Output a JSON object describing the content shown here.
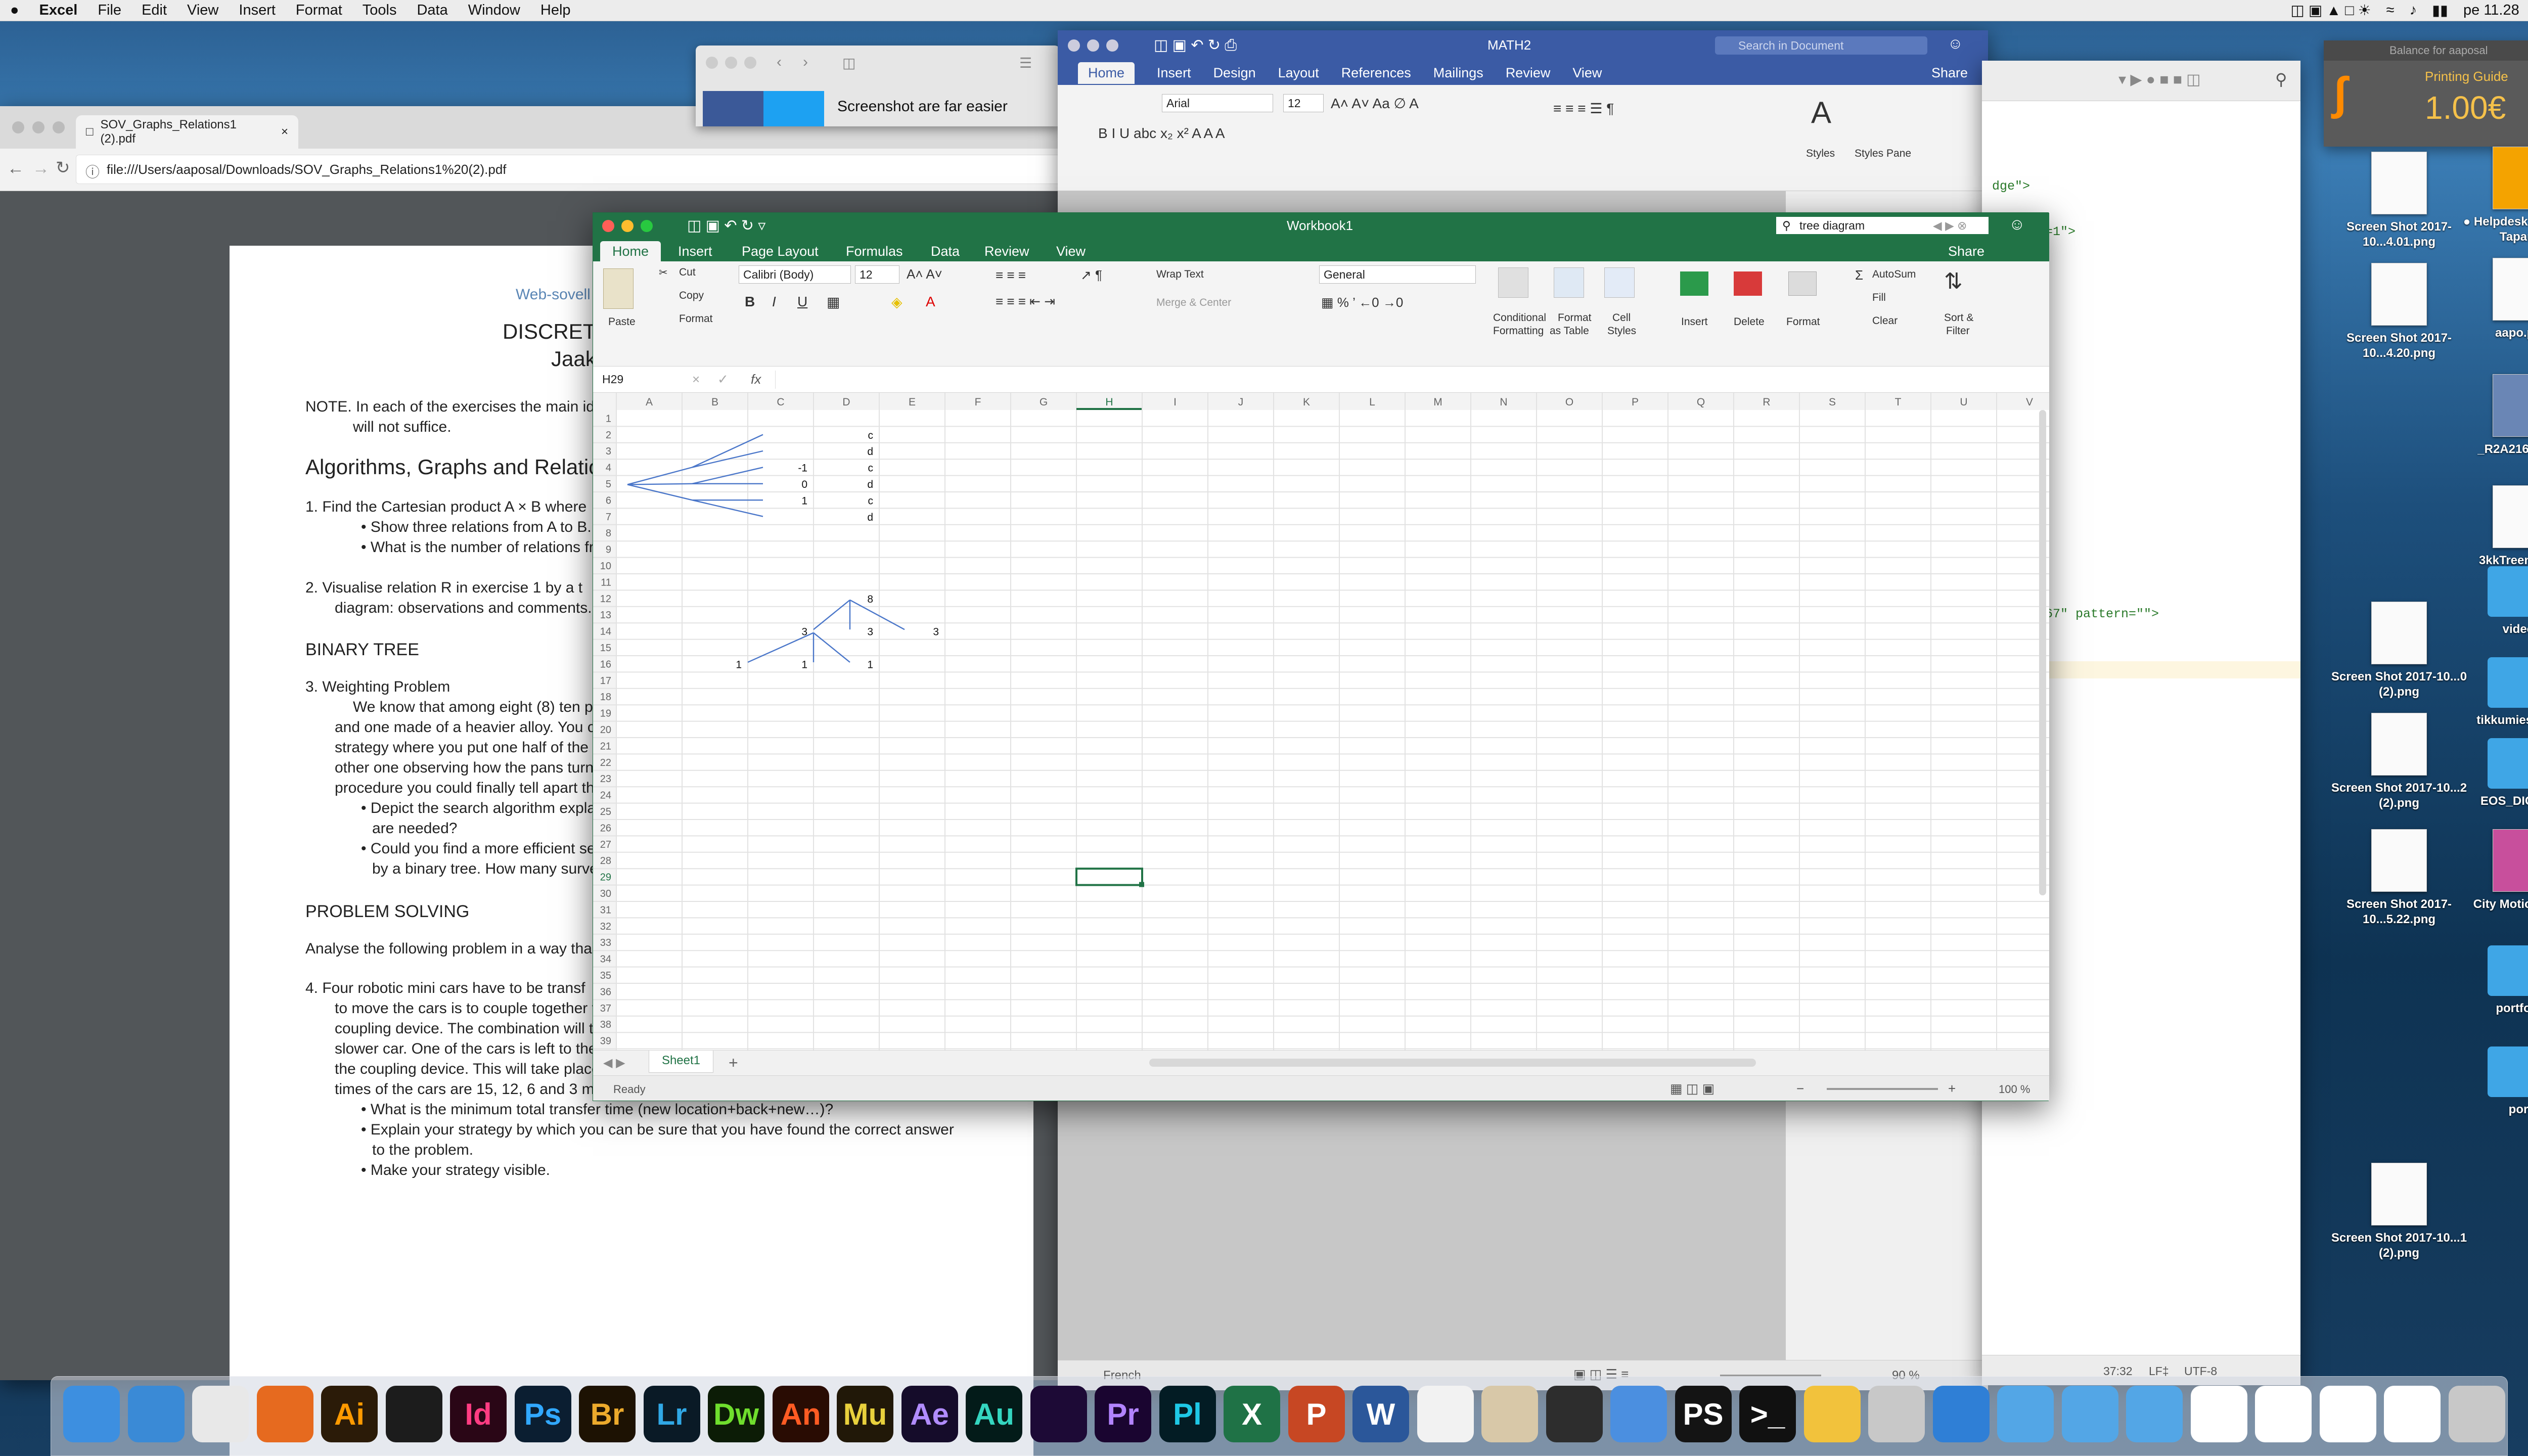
{
  "menubar": {
    "app": "Excel",
    "items": [
      "File",
      "Edit",
      "View",
      "Insert",
      "Format",
      "Tools",
      "Data",
      "Window",
      "Help"
    ],
    "clock": "pe 11.28"
  },
  "pdf_window": {
    "tab_title": "SOV_Graphs_Relations1 (2).pdf",
    "url": "file:///Users/aaposal/Downloads/SOV_Graphs_Relations1%20(2).pdf",
    "lines": [
      "Web-sovell",
      "DISCRET",
      "Jaak",
      "NOTE.  In each of the exercises the main ide",
      "will not suffice.",
      "Algorithms, Graphs and Relation",
      "1.     Find the Cartesian product A × B where",
      "•  Show three relations from A to B.",
      "•  What is the number of relations fro",
      "2.     Visualise relation R in exercise 1 by a t",
      "diagram: observations and comments.",
      "BINARY TREE",
      "3.     Weighting Problem",
      "We know that among eight (8) ten p",
      "and one made of a heavier alloy. You c",
      "strategy where you put one half of the",
      "other one observing how the pans turn",
      "procedure you could finally tell apart th",
      "•  Depict the search algorithm expla",
      "are needed?",
      "•  Could you find a more efficient se",
      "by a binary tree. How many surve",
      "PROBLEM SOLVING",
      "Analyse the following problem in a way tha",
      "4.     Four robotic mini cars have to be transf",
      "to move the cars is to couple together t",
      "coupling device. The combination will t",
      "slower car. One of the cars is left to the",
      "the coupling device. This will take place",
      "times of the cars are 15, 12, 6 and 3 mi",
      "•  What is the minimum total transfer time (new location+back+new…)?",
      "•  Explain your strategy by which you can be sure that you have found the correct answer",
      "to the problem.",
      "•  Make your strategy visible."
    ]
  },
  "browser_mini": {
    "text": "Screenshot are far easier"
  },
  "word_window": {
    "title": "MATH2",
    "search_placeholder": "Search in Document",
    "tabs": [
      "Home",
      "Insert",
      "Design",
      "Layout",
      "References",
      "Mailings",
      "Review",
      "View"
    ],
    "share": "Share",
    "font": "Arial",
    "size": "12",
    "styles": "Styles",
    "styles_pane": "Styles Pane",
    "language": "French",
    "zoom": "90 %"
  },
  "editor_window": {
    "lines": [
      "dge\">",
      "l-scale=1\">",
      "501234567\" pattern=\"\">"
    ],
    "status_pos": "37:32",
    "status_lf": "LF‡",
    "status_enc": "UTF-8"
  },
  "printing_widget": {
    "title": "Balance for aaposal",
    "label": "Printing Guide",
    "amount": "1.00€"
  },
  "excel": {
    "title": "Workbook1",
    "search_value": "tree diagram",
    "tabs": [
      "Home",
      "Insert",
      "Page Layout",
      "Formulas",
      "Data",
      "Review",
      "View"
    ],
    "share": "Share",
    "ribbon": {
      "paste": "Paste",
      "cut": "Cut",
      "copy": "Copy",
      "format": "Format",
      "font": "Calibri (Body)",
      "size": "12",
      "wrap_text": "Wrap Text",
      "merge_center": "Merge & Center",
      "number_format": "General",
      "conditional_formatting": [
        "Conditional",
        "Formatting"
      ],
      "format_as_table": [
        "Format",
        "as Table"
      ],
      "cell_styles": [
        "Cell",
        "Styles"
      ],
      "insert": "Insert",
      "delete": "Delete",
      "format_cells": "Format",
      "autosum": "AutoSum",
      "fill": "Fill",
      "clear": "Clear",
      "sort_filter": [
        "Sort &",
        "Filter"
      ]
    },
    "name_box": "H29",
    "fx": "fx",
    "columns": [
      "A",
      "B",
      "C",
      "D",
      "E",
      "F",
      "G",
      "H",
      "I",
      "J",
      "K",
      "L",
      "M",
      "N",
      "O",
      "P",
      "Q",
      "R",
      "S",
      "T",
      "U",
      "V"
    ],
    "rows": 40,
    "selected_cell": {
      "col": "H",
      "row": 29
    },
    "cells": [
      {
        "col": "D",
        "row": 2,
        "v": "c"
      },
      {
        "col": "D",
        "row": 3,
        "v": "d"
      },
      {
        "col": "C",
        "row": 4,
        "v": "-1"
      },
      {
        "col": "D",
        "row": 4,
        "v": "c"
      },
      {
        "col": "C",
        "row": 5,
        "v": "0"
      },
      {
        "col": "D",
        "row": 5,
        "v": "d"
      },
      {
        "col": "C",
        "row": 6,
        "v": "1"
      },
      {
        "col": "D",
        "row": 6,
        "v": "c"
      },
      {
        "col": "D",
        "row": 7,
        "v": "d"
      },
      {
        "col": "D",
        "row": 12,
        "v": "8"
      },
      {
        "col": "C",
        "row": 14,
        "v": "3"
      },
      {
        "col": "D",
        "row": 14,
        "v": "3"
      },
      {
        "col": "E",
        "row": 14,
        "v": "3"
      },
      {
        "col": "B",
        "row": 16,
        "v": "1"
      },
      {
        "col": "C",
        "row": 16,
        "v": "1"
      },
      {
        "col": "D",
        "row": 16,
        "v": "1"
      }
    ],
    "sheet_tab": "Sheet1",
    "status": "Ready",
    "zoom": "100 %"
  },
  "desktop_icons": [
    {
      "label": "Screen Shot 2017-10...4.01.png",
      "kind": "shot"
    },
    {
      "label": "● Helpdesk - Ilmoita Tapaus",
      "kind": "help"
    },
    {
      "label": "Screen Shot 2017-10...4.20.png",
      "kind": "shot"
    },
    {
      "label": "aapo.pdf",
      "kind": "pdf"
    },
    {
      "label": "_R2A2169.CR2",
      "kind": "raw"
    },
    {
      "label": "3kkTreeni.xlsx",
      "kind": "doc"
    },
    {
      "label": "videot",
      "kind": "folder"
    },
    {
      "label": "Screen Shot 2017-10...0 (2).png",
      "kind": "shot"
    },
    {
      "label": "tikkumiesvideo",
      "kind": "folder"
    },
    {
      "label": "Screen Shot 2017-10...2 (2).png",
      "kind": "shot"
    },
    {
      "label": "EOS_DIGITAL",
      "kind": "folder"
    },
    {
      "label": "Screen Shot 2017-10...5.22.png",
      "kind": "shot"
    },
    {
      "label": "City Motion.mp3",
      "kind": "music"
    },
    {
      "label": "portfolio",
      "kind": "folder"
    },
    {
      "label": "port",
      "kind": "folder"
    },
    {
      "label": "Screen Shot 2017-10...1 (2).png",
      "kind": "shot"
    }
  ],
  "dock": [
    {
      "name": "finder",
      "label": "",
      "color": "#3d8fe0"
    },
    {
      "name": "safari",
      "label": "",
      "color": "#3a8ad6"
    },
    {
      "name": "chrome",
      "label": "",
      "color": "#e8e8e8"
    },
    {
      "name": "firefox",
      "label": "",
      "color": "#e66a1f"
    },
    {
      "name": "illustrator",
      "label": "Ai",
      "color": "#2b1b08",
      "fg": "#ff9a00"
    },
    {
      "name": "acrobat",
      "label": "",
      "color": "#1c1c1c",
      "fg": "#ff2a1a"
    },
    {
      "name": "indesign",
      "label": "Id",
      "color": "#2a0616",
      "fg": "#ff3c82"
    },
    {
      "name": "photoshop",
      "label": "Ps",
      "color": "#0b1e31",
      "fg": "#31a8ff"
    },
    {
      "name": "bridge",
      "label": "Br",
      "color": "#1d1203",
      "fg": "#ecaa2c"
    },
    {
      "name": "lightroom",
      "label": "Lr",
      "color": "#0a1a26",
      "fg": "#30a8e6"
    },
    {
      "name": "dreamweaver",
      "label": "Dw",
      "color": "#0c1c06",
      "fg": "#6fde2d"
    },
    {
      "name": "animate",
      "label": "An",
      "color": "#290c03",
      "fg": "#ff5b23"
    },
    {
      "name": "muse",
      "label": "Mu",
      "color": "#211808",
      "fg": "#e8d03c"
    },
    {
      "name": "aftereffects",
      "label": "Ae",
      "color": "#150c2a",
      "fg": "#b18cff"
    },
    {
      "name": "audition",
      "label": "Au",
      "color": "#031b19",
      "fg": "#34d6c0"
    },
    {
      "name": "mediaencoder",
      "label": "",
      "color": "#1d0a36",
      "fg": "#9b6cff"
    },
    {
      "name": "premiere",
      "label": "Pr",
      "color": "#1a0530",
      "fg": "#b283ff"
    },
    {
      "name": "prelude",
      "label": "Pl",
      "color": "#031c24",
      "fg": "#1ec8e6"
    },
    {
      "name": "excel",
      "label": "X",
      "color": "#1f7246"
    },
    {
      "name": "powerpoint",
      "label": "P",
      "color": "#c74723"
    },
    {
      "name": "word",
      "label": "W",
      "color": "#2b579a"
    },
    {
      "name": "textedit",
      "label": "",
      "color": "#f2f2f2"
    },
    {
      "name": "home",
      "label": "",
      "color": "#d8c8a8"
    },
    {
      "name": "drive",
      "label": "",
      "color": "#2d2d2d"
    },
    {
      "name": "xcode",
      "label": "",
      "color": "#4b8fe0"
    },
    {
      "name": "phpstorm",
      "label": "PS",
      "color": "#141414"
    },
    {
      "name": "terminal",
      "label": ">_",
      "color": "#111111"
    },
    {
      "name": "coda",
      "label": "",
      "color": "#f2c23c"
    },
    {
      "name": "preview",
      "label": "",
      "color": "#c8c8c8"
    },
    {
      "name": "network",
      "label": "",
      "color": "#2f7fd6"
    },
    {
      "name": "applications",
      "label": "",
      "color": "#53a6e6"
    },
    {
      "name": "home-folder",
      "label": "",
      "color": "#53a6e6"
    },
    {
      "name": "documents",
      "label": "",
      "color": "#53a6e6"
    },
    {
      "name": "doc1",
      "label": "",
      "color": "#ffffff"
    },
    {
      "name": "doc2",
      "label": "",
      "color": "#ffffff"
    },
    {
      "name": "doc3",
      "label": "",
      "color": "#ffffff"
    },
    {
      "name": "doc4",
      "label": "",
      "color": "#ffffff"
    },
    {
      "name": "trash",
      "label": "",
      "color": "#c8c8c8"
    }
  ]
}
